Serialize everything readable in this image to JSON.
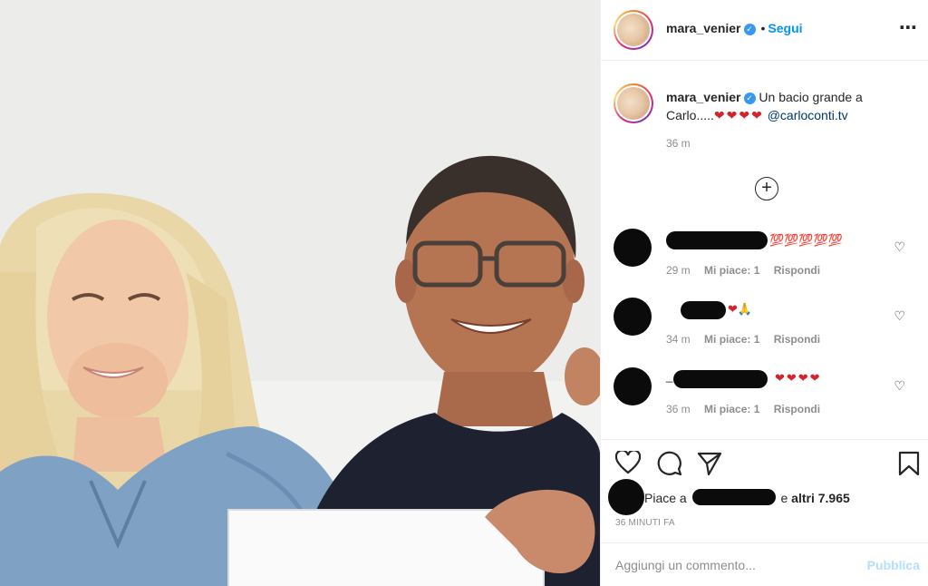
{
  "post": {
    "username": "mara_venier",
    "follow_label": "Segui",
    "dot": "•",
    "more": "•••"
  },
  "caption": {
    "username": "mara_venier",
    "text": "Un bacio grande a Carlo.....",
    "hearts": "❤❤❤❤",
    "mention": "@carloconti.tv",
    "time": "36 m"
  },
  "add_comments_icon": "plus-circle-icon",
  "comments": [
    {
      "extra": "💯💯💯💯💯",
      "time": "29 m",
      "likes": "Mi piace: 1",
      "reply": "Rispondi"
    },
    {
      "extra": "❤🙏",
      "time": "34 m",
      "likes": "Mi piace: 1",
      "reply": "Rispondi"
    },
    {
      "prefix": "_",
      "extra": "❤❤❤❤",
      "time": "36 m",
      "likes": "Mi piace: 1",
      "reply": "Rispondi"
    }
  ],
  "likes": {
    "prefix": "Piace a",
    "conj": "e",
    "others": "altri 7.965"
  },
  "timestamp": "36 MINUTI FA",
  "comment_box": {
    "placeholder": "Aggiungi un commento...",
    "publish": "Pubblica"
  },
  "colors": {
    "accent": "#0095f6",
    "heart": "#d4232a",
    "verified": "#3897f0"
  }
}
